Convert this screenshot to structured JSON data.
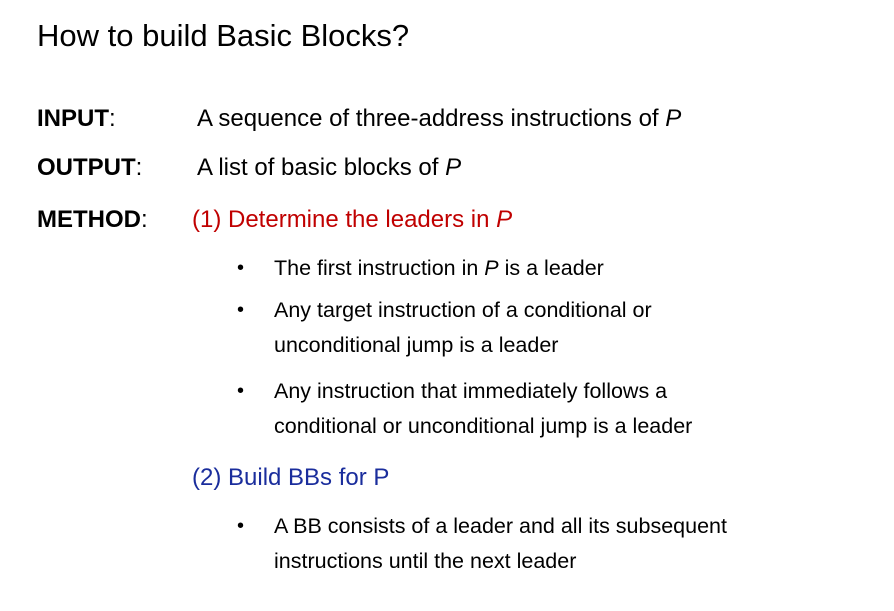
{
  "title": "How to build Basic Blocks?",
  "input": {
    "label": "INPUT",
    "colon": ":",
    "text_before": "A sequence of three-address instructions of ",
    "var": "P"
  },
  "output": {
    "label": "OUTPUT",
    "colon": ":",
    "text_before": "A list of basic blocks of ",
    "var": "P"
  },
  "method": {
    "label": "METHOD",
    "colon": ":",
    "step1": {
      "text_before": "(1) Determine the leaders in ",
      "var": "P",
      "color": "#c00000"
    },
    "step1_bullets": [
      {
        "line1_before": "The first instruction in ",
        "line1_var": "P",
        "line1_after": " is a leader"
      },
      {
        "line1": "Any target instruction of a conditional or",
        "line2": "unconditional jump is a leader"
      },
      {
        "line1": "Any instruction that immediately follows a",
        "line2": "conditional or unconditional jump is a leader"
      }
    ],
    "step2": {
      "text": "(2) Build BBs for P",
      "color": "#1a2d9c"
    },
    "step2_bullets": [
      {
        "line1": "A BB consists of a leader and all its subsequent",
        "line2": "instructions until the next leader"
      }
    ]
  },
  "bullet_glyph": "•"
}
